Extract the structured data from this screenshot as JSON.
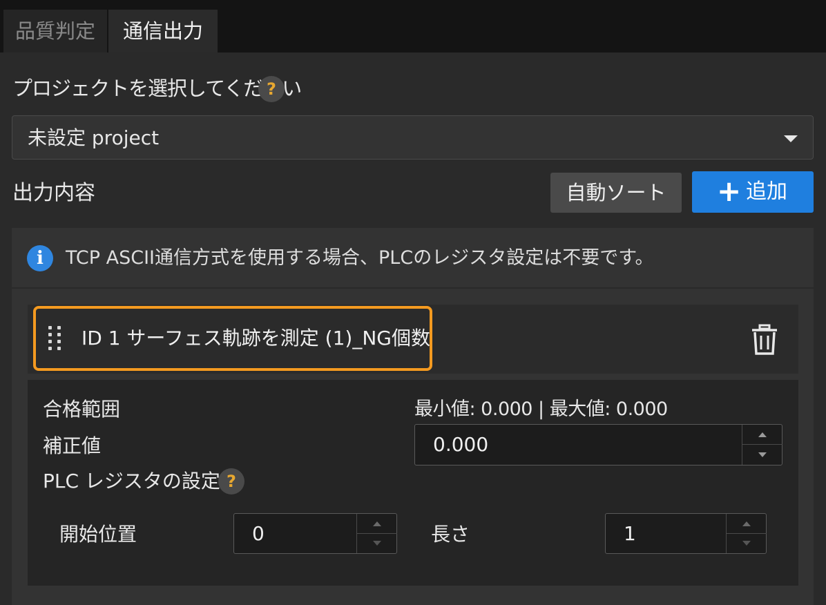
{
  "tabs": [
    {
      "label": "品質判定",
      "active": false
    },
    {
      "label": "通信出力",
      "active": true
    }
  ],
  "project": {
    "label": "プロジェクトを選択してください",
    "help": "?",
    "selected": "未設定 project"
  },
  "output": {
    "label": "出力内容",
    "sort_button": "自動ソート",
    "add_button": "追加"
  },
  "info": {
    "icon": "i",
    "text": "TCP ASCII通信方式を使用する場合、PLCのレジスタ設定は不要です。"
  },
  "item": {
    "title": "ID 1  サーフェス軌跡を測定 (1)_NG個数",
    "pass_range_label": "合格範囲",
    "range_text": "最小値: 0.000 | 最大値: 0.000",
    "offset_label": "補正値",
    "offset_value": "0.000",
    "plc_label": "PLC レジスタの設定",
    "plc_help": "?",
    "start_label": "開始位置",
    "start_value": "0",
    "length_label": "長さ",
    "length_value": "1"
  },
  "colors": {
    "accent": "#1f7fdf",
    "highlight": "#f49a20",
    "help_icon": "#e8a830"
  }
}
